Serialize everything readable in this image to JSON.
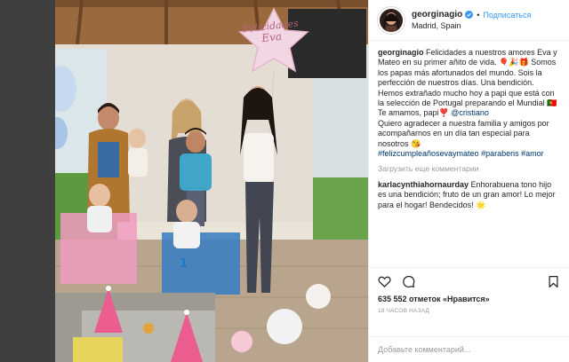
{
  "post": {
    "username": "georginagio",
    "follow_label": "Подписаться",
    "location": "Madrid, Spain",
    "dot": "•"
  },
  "photo": {
    "balloon_line1": "Felicidades",
    "balloon_line2": "Eva",
    "shirt_number": "1"
  },
  "caption": {
    "author": "georginagio",
    "text_part1": "Felicidades a nuestros amores Eva y Mateo en su primer añito de vida. 🎈🎉🎁 Somos los papas más afortunados del mundo. Sois la perfección de nuestros días. Una bendición.\nHemos extrañado mucho hoy a papi que está con la selección de Portugal preparando el Mundial 🇵🇹 Te amamos, papi❣️ ",
    "mention": "@cristiano",
    "text_part2": "\nQuiero agradecer a nuestra familia y amigos por acompañarnos en un día tan especial para nosotros 😘",
    "hashtags": "\n#felizcumpleañosevaymateo #parabens #amor"
  },
  "load_more": "Загрузить еще комментарии",
  "comment": {
    "author": "karlacynthiahornaurday",
    "text": " Enhorabuena tono hijo es una bendición; fruto de un gran amor! Lo mejor para el hogar! Bendecidos! 🌟"
  },
  "likes": "635 552 отметок «Нравится»",
  "time_ago": "18 ЧАСОВ НАЗАД",
  "add_comment_placeholder": "Добавьте комментарий...",
  "colors": {
    "link": "#003569",
    "follow": "#3897f0",
    "verified": "#3897f0",
    "muted": "#999999"
  },
  "icons": [
    "heart-icon",
    "comment-icon",
    "bookmark-icon",
    "verified-badge-icon"
  ]
}
